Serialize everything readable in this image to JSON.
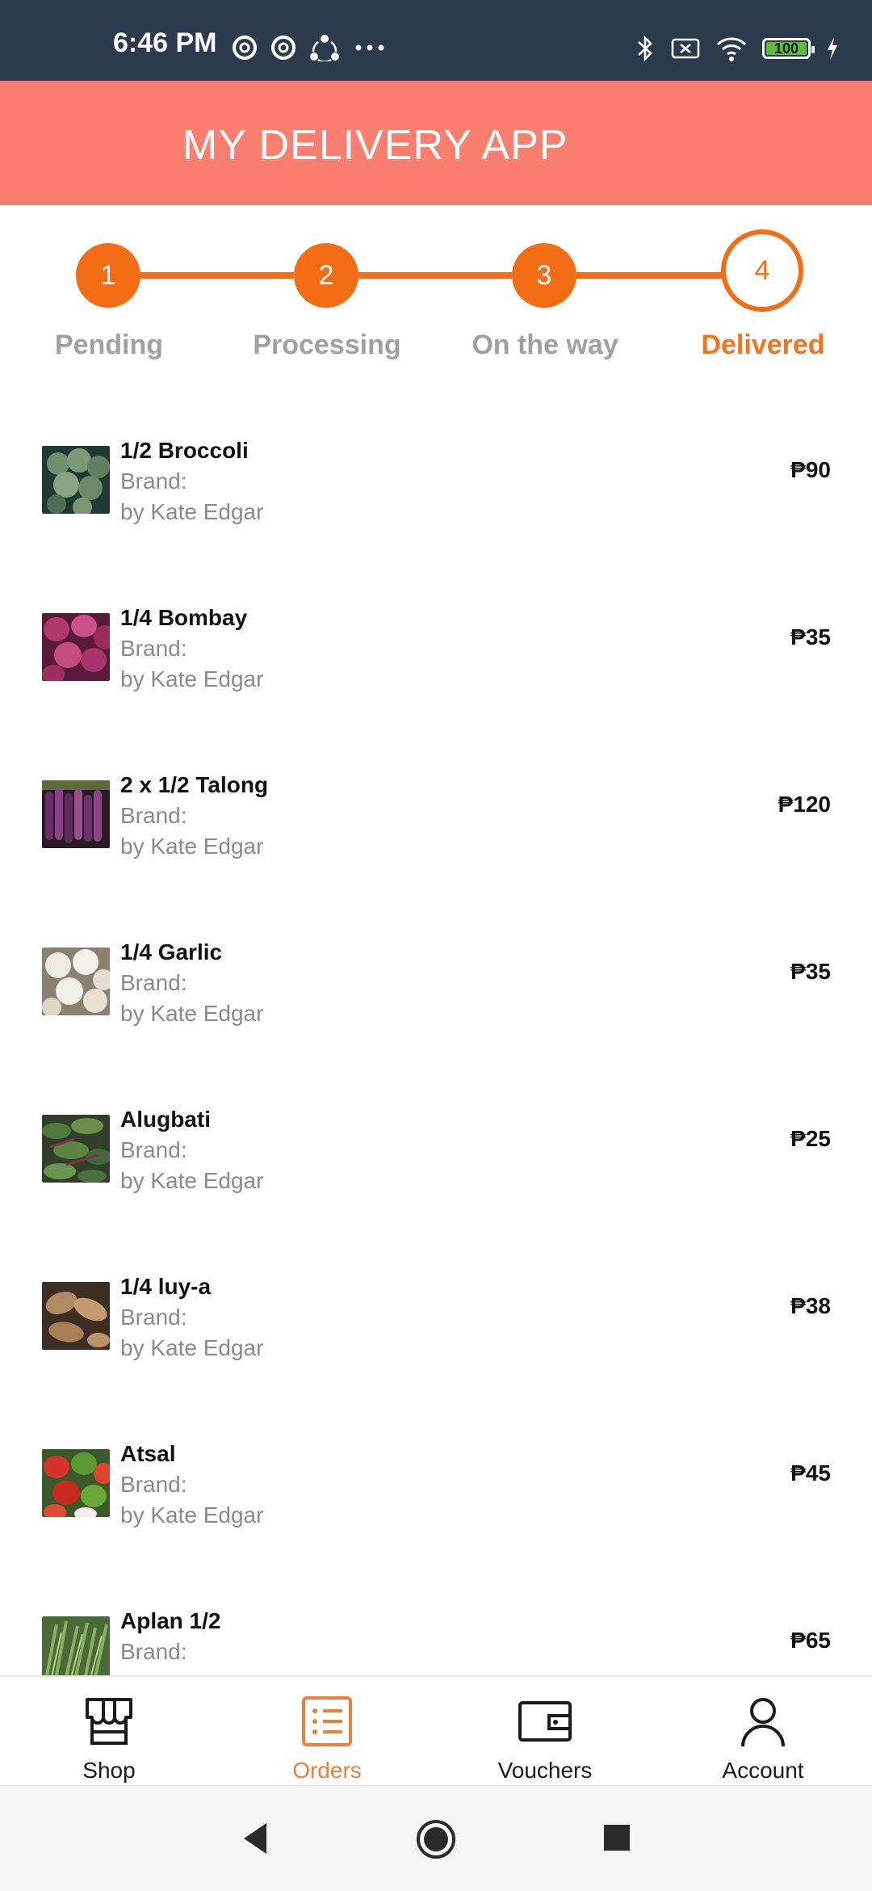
{
  "status_bar": {
    "time": "6:46 PM",
    "battery": "100",
    "left_icons": [
      "at-sign-icon",
      "at-sign-icon",
      "share-icon",
      "more-dots-icon"
    ],
    "right_icons": [
      "bluetooth-icon",
      "no-sim-icon",
      "wifi-icon",
      "battery-icon",
      "charging-icon"
    ]
  },
  "header": {
    "title": "MY DELIVERY APP"
  },
  "stepper": {
    "steps": [
      {
        "number": "1",
        "label": "Pending"
      },
      {
        "number": "2",
        "label": "Processing"
      },
      {
        "number": "3",
        "label": "On the way"
      },
      {
        "number": "4",
        "label": "Delivered"
      }
    ],
    "active_step": 4
  },
  "items": [
    {
      "name": "1/2 Broccoli",
      "brand": "Brand:",
      "seller": "by Kate Edgar",
      "price": "₱90",
      "thumb": "broccoli"
    },
    {
      "name": "1/4 Bombay",
      "brand": "Brand:",
      "seller": "by Kate Edgar",
      "price": "₱35",
      "thumb": "red-onion"
    },
    {
      "name": "2 x 1/2 Talong",
      "brand": "Brand:",
      "seller": "by Kate Edgar",
      "price": "₱120",
      "thumb": "eggplant"
    },
    {
      "name": "1/4 Garlic",
      "brand": "Brand:",
      "seller": "by Kate Edgar",
      "price": "₱35",
      "thumb": "garlic"
    },
    {
      "name": "Alugbati",
      "brand": "Brand:",
      "seller": "by Kate Edgar",
      "price": "₱25",
      "thumb": "alugbati"
    },
    {
      "name": "1/4 luy-a",
      "brand": "Brand:",
      "seller": "by Kate Edgar",
      "price": "₱38",
      "thumb": "ginger"
    },
    {
      "name": "Atsal",
      "brand": "Brand:",
      "seller": "by Kate Edgar",
      "price": "₱45",
      "thumb": "bell-pepper"
    },
    {
      "name": "Aplan 1/2",
      "brand": "Brand:",
      "seller": "",
      "price": "₱65",
      "thumb": "greens"
    }
  ],
  "bottom_nav": [
    {
      "label": "Shop",
      "icon": "shop-icon"
    },
    {
      "label": "Orders",
      "icon": "orders-icon"
    },
    {
      "label": "Vouchers",
      "icon": "wallet-icon"
    },
    {
      "label": "Account",
      "icon": "account-icon"
    }
  ],
  "active_tab": "Orders",
  "colors": {
    "status_bar": "#2c3a4d",
    "header": "#fa7f6f",
    "accent": "#f46d14",
    "active_tab": "#e5813c"
  }
}
